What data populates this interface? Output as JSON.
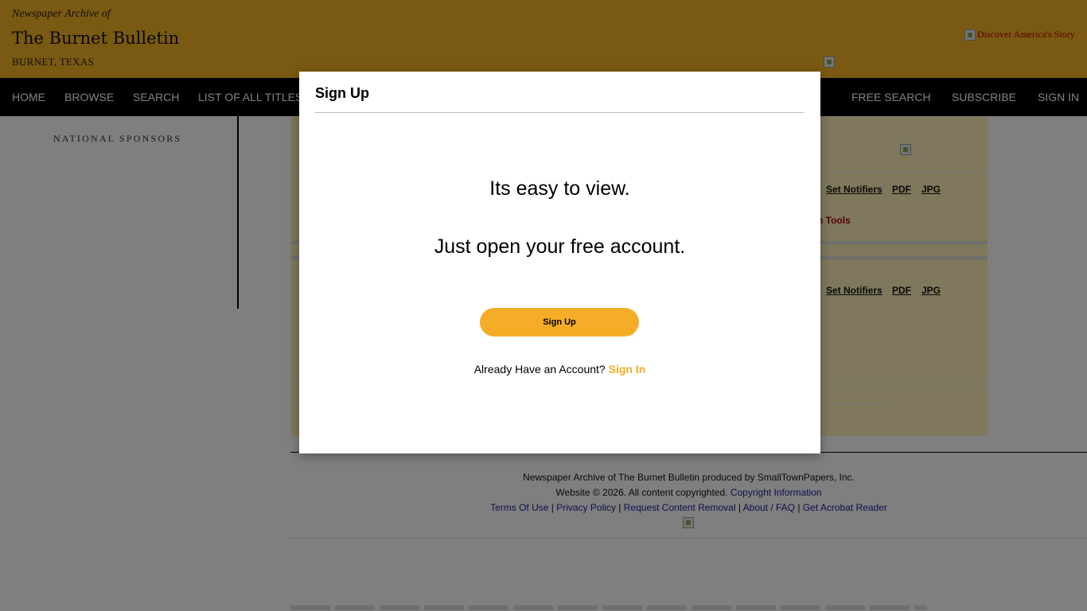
{
  "header": {
    "archive_of": "Newspaper Archive of",
    "title": "The Burnet Bulletin",
    "location": "BURNET, TEXAS",
    "discover_link": "Discover America's Story"
  },
  "nav": {
    "left": [
      "HOME",
      "BROWSE",
      "SEARCH",
      "LIST OF ALL TITLES"
    ],
    "right": [
      "FREE SEARCH",
      "SUBSCRIBE",
      "SIGN IN"
    ]
  },
  "sidebar": {
    "sponsors_label": "NATIONAL SPONSORS"
  },
  "content": {
    "row1": {
      "set_notifiers": "Set Notifiers",
      "pdf": "PDF",
      "jpg": "JPG",
      "tools": "n Tools"
    },
    "row2": {
      "set_notifiers": "Set Notifiers",
      "pdf": "PDF",
      "jpg": "JPG"
    }
  },
  "footer": {
    "line1": "Newspaper Archive of The Burnet Bulletin produced by SmallTownPapers, Inc.",
    "line2": "Website © 2026. All content copyrighted.",
    "copyright_link": "Copyright Information",
    "links": [
      "Terms Of Use",
      "Privacy Policy",
      "Request Content Removal",
      "About / FAQ",
      "Get Acrobat Reader"
    ],
    "separator": "|"
  },
  "modal": {
    "title": "Sign Up",
    "line1": "Its easy to view.",
    "line2": "Just open your free account.",
    "button": "Sign Up",
    "already_text": "Already Have an Account?",
    "signin_link": "Sign In"
  },
  "colors": {
    "header_bg": "#f5b325",
    "nav_bg": "#000000",
    "accent": "#f5ad28",
    "content_bg": "#fff1b8"
  }
}
